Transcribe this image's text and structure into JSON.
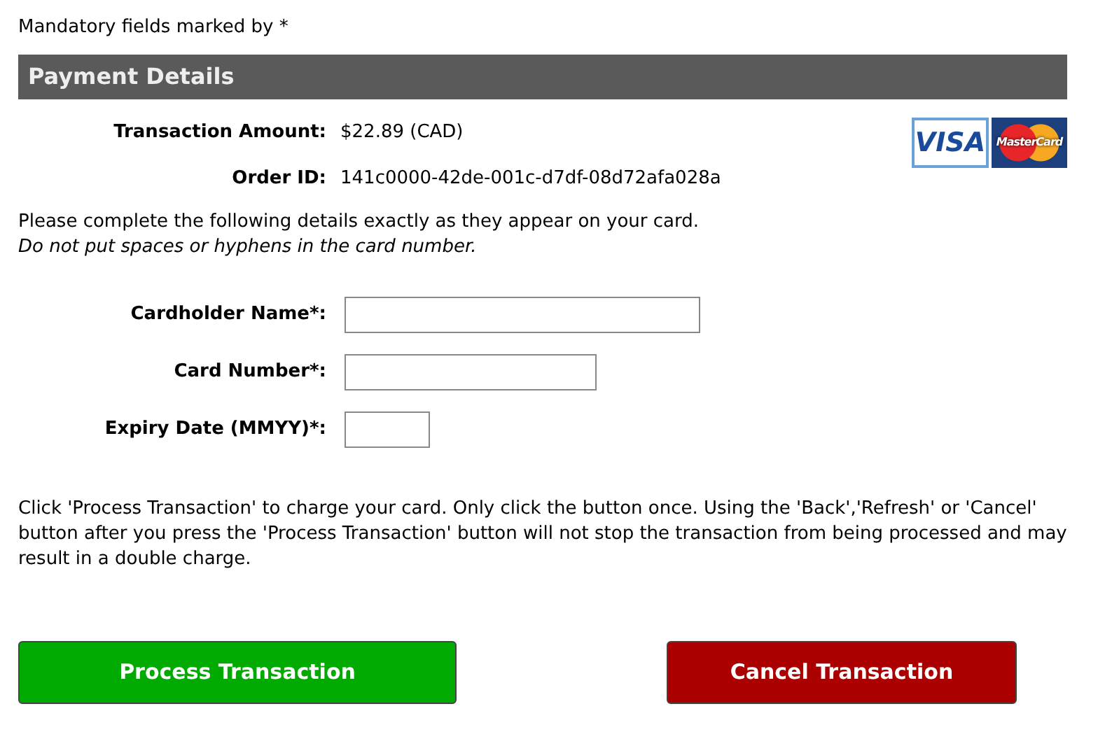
{
  "mandatory_note": "Mandatory fields marked by *",
  "section_title": "Payment Details",
  "summary": [
    {
      "label": "Transaction Amount:",
      "value": "$22.89 (CAD)"
    },
    {
      "label": "Order ID:",
      "value": "141c0000-42de-001c-d7df-08d72afa028a"
    }
  ],
  "card_logos": [
    {
      "kind": "visa",
      "text": "VISA"
    },
    {
      "kind": "mastercard",
      "text": "MasterCard"
    }
  ],
  "instructions": "Please complete the following details exactly as they appear on your card.",
  "hint": "Do not put spaces or hyphens in the card number.",
  "fields": [
    {
      "label": "Cardholder Name*:"
    },
    {
      "label": "Card Number*:"
    },
    {
      "label": "Expiry Date (MMYY)*:"
    }
  ],
  "warning": "Click 'Process Transaction' to charge your card. Only click the button once. Using the 'Back','Refresh' or 'Cancel' button after you press the 'Process Transaction' button will not stop the transaction from being processed and may result in a double charge.",
  "buttons": [
    {
      "label": "Process Transaction",
      "kind": "primary"
    },
    {
      "label": "Cancel Transaction",
      "kind": "danger"
    }
  ]
}
